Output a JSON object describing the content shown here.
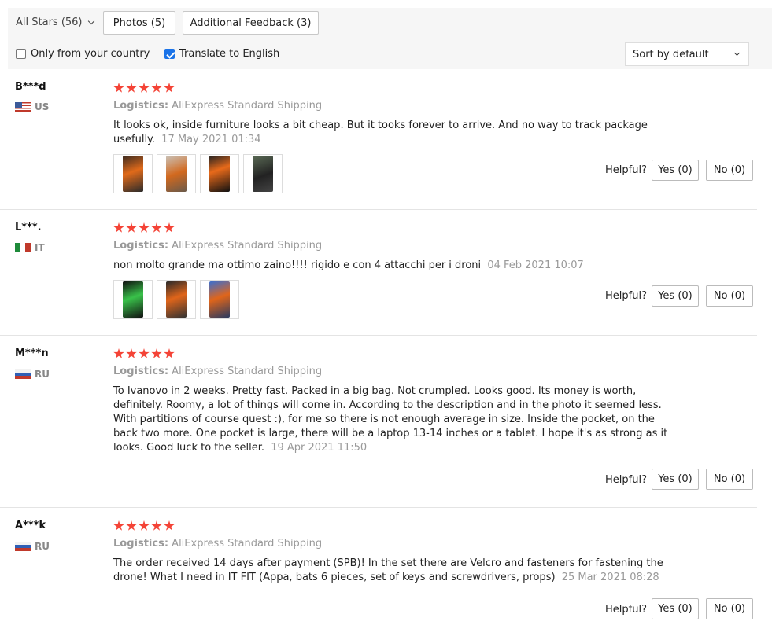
{
  "filters": {
    "all_stars": "All Stars (56)",
    "photos": "Photos (5)",
    "additional_feedback": "Additional Feedback (3)",
    "only_country": "Only from your country",
    "only_country_checked": false,
    "translate": "Translate to English",
    "translate_checked": true,
    "sort": "Sort by default"
  },
  "labels": {
    "logistics": "Logistics:",
    "helpful": "Helpful?",
    "yes": "Yes (0)",
    "no": "No (0)"
  },
  "reviews": [
    {
      "user": "B***d",
      "country": "US",
      "flag": "us-flag",
      "stars": 5,
      "shipping": "AliExpress Standard Shipping",
      "text": "It looks ok, inside furniture looks a bit cheap. But it tooks forever to arrive. And no way to track package usefully.",
      "date": "17 May 2021 01:34",
      "photo_count": 4
    },
    {
      "user": "L***.",
      "country": "IT",
      "flag": "italy-flag",
      "stars": 5,
      "shipping": "AliExpress Standard Shipping",
      "text": "non molto grande ma ottimo zaino!!!! rigido e con 4 attacchi per i droni",
      "date": "04 Feb 2021 10:07",
      "photo_count": 3
    },
    {
      "user": "M***n",
      "country": "RU",
      "flag": "russia-flag",
      "stars": 5,
      "shipping": "AliExpress Standard Shipping",
      "text": "To Ivanovo in 2 weeks. Pretty fast. Packed in a big bag. Not crumpled. Looks good. Its money is worth, definitely. Roomy, a lot of things will come in. According to the description and in the photo it seemed less. With partitions of course quest :), for me so there is not enough average in size. Inside the pocket, on the back two more. One pocket is large, there will be a laptop 13-14 inches or a tablet. I hope it's as strong as it looks. Good luck to the seller.",
      "date": "19 Apr 2021 11:50",
      "photo_count": 0
    },
    {
      "user": "A***k",
      "country": "RU",
      "flag": "russia-flag",
      "stars": 5,
      "shipping": "AliExpress Standard Shipping",
      "text": "The order received 14 days after payment (SPB)! In the set there are Velcro and fasteners for fastening the drone! What I need in IT FIT (Appa, bats 6 pieces, set of keys and screwdrivers, props)",
      "date": "25 Mar 2021 08:28",
      "photo_count": 0
    }
  ]
}
